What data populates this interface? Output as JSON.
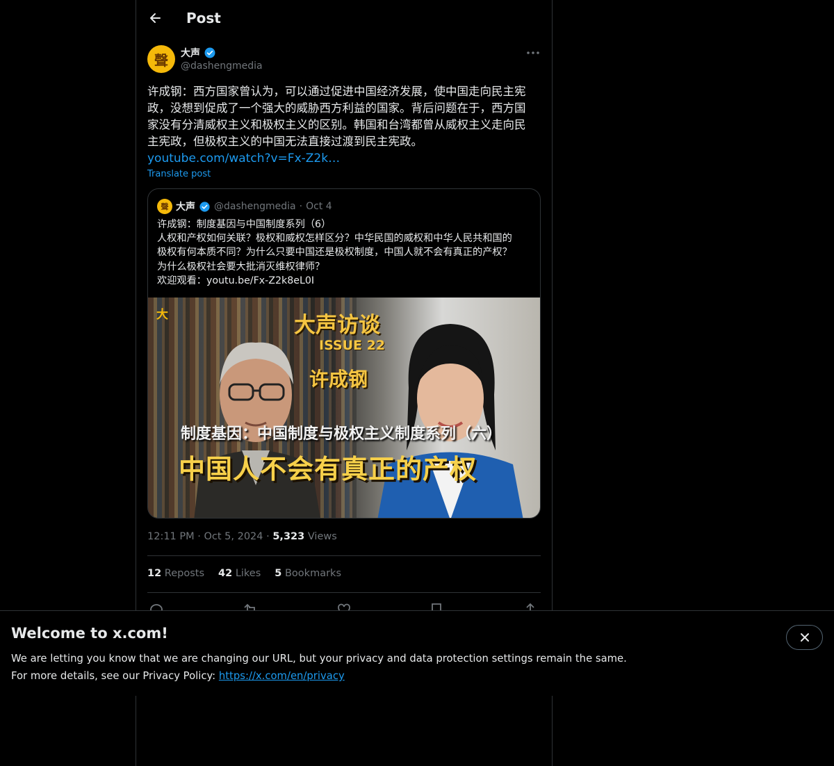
{
  "header": {
    "title": "Post",
    "back_icon": "arrow-left-icon"
  },
  "post": {
    "avatar_glyph": "聲",
    "display_name": "大声",
    "handle": "@dashengmedia",
    "verified": true,
    "text_lines": [
      "许成钢：西方国家曾认为，可以通过促进中国经济发展，使中国走向民主宪",
      "政，没想到促成了一个强大的威胁西方利益的国家。背后问题在于，西方国",
      "家没有分清威权主义和极权主义的区别。韩国和台湾都曾从威权主义走向民",
      "主宪政，但极权主义的中国无法直接过渡到民主宪政。"
    ],
    "link": "youtube.com/watch?v=Fx-Z2k…",
    "translate": "Translate post"
  },
  "quote": {
    "avatar_glyph": "聲",
    "display_name": "大声",
    "handle": "@dashengmedia",
    "separator": "·",
    "date": "Oct 4",
    "text": "许成钢：制度基因与中国制度系列（6）\n人权和产权如何关联？极权和威权怎样区分？中华民国的威权和中华人民共和国的\n极权有何本质不同？为什么只要中国还是极权制度，中国人就不会有真正的产权？\n为什么极权社会要大批消灭维权律师？\n欢迎观看：youtu.be/Fx-Z2k8eL0I",
    "image": {
      "logo": "大",
      "brand": "大声访谈",
      "issue": "ISSUE 22",
      "guest": "许成钢",
      "subtitle": "制度基因：中国制度与极权主义制度系列（六）",
      "headline": "中国人不会有真正的产权"
    }
  },
  "meta": {
    "time": "12:11 PM",
    "dot": "·",
    "date": "Oct 5, 2024",
    "views_count": "5,323",
    "views_label": "Views"
  },
  "stats": {
    "reposts_count": "12",
    "reposts_label": "Reposts",
    "likes_count": "42",
    "likes_label": "Likes",
    "bookmarks_count": "5",
    "bookmarks_label": "Bookmarks"
  },
  "banner": {
    "title": "Welcome to x.com!",
    "line1": "We are letting you know that we are changing our URL, but your privacy and data protection settings remain the same.",
    "line2_prefix": "For more details, see our Privacy Policy: ",
    "link": "https://x.com/en/privacy"
  },
  "colors": {
    "accent": "#1d9bf0",
    "brand_gold": "#f5b90a",
    "muted": "#71767b"
  }
}
